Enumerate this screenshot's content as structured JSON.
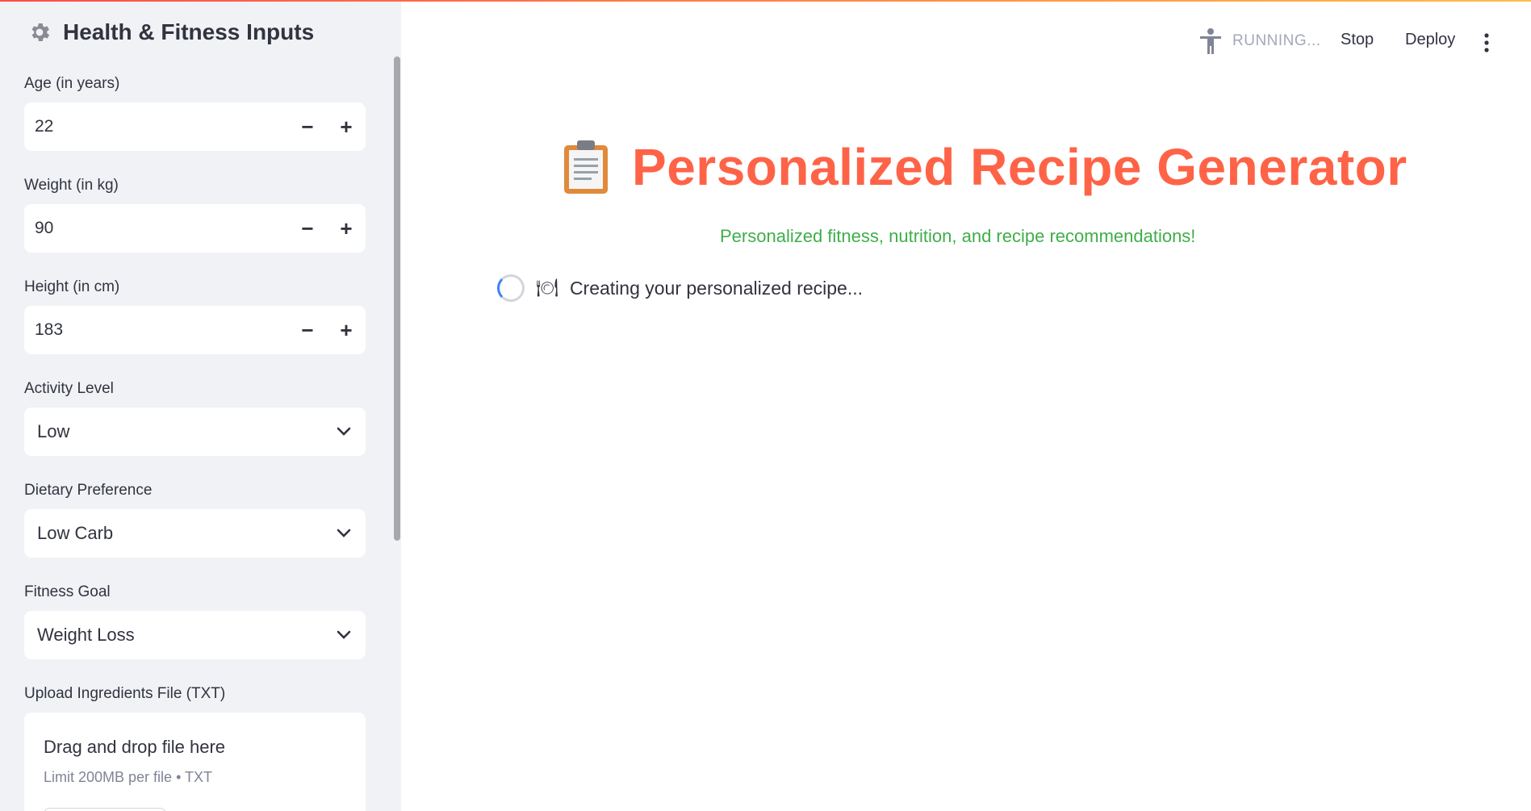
{
  "sidebar": {
    "title": "Health & Fitness Inputs",
    "title_icon": "gear-icon",
    "age": {
      "label": "Age (in years)",
      "value": "22",
      "minus": "−",
      "plus": "+"
    },
    "weight": {
      "label": "Weight (in kg)",
      "value": "90",
      "minus": "−",
      "plus": "+"
    },
    "height": {
      "label": "Height (in cm)",
      "value": "183",
      "minus": "−",
      "plus": "+"
    },
    "activity": {
      "label": "Activity Level",
      "value": "Low"
    },
    "diet": {
      "label": "Dietary Preference",
      "value": "Low Carb"
    },
    "goal": {
      "label": "Fitness Goal",
      "value": "Weight Loss"
    },
    "upload": {
      "label": "Upload Ingredients File (TXT)",
      "drop_text": "Drag and drop file here",
      "limit_text": "Limit 200MB per file • TXT"
    }
  },
  "header": {
    "status": "RUNNING...",
    "stop": "Stop",
    "deploy": "Deploy"
  },
  "main": {
    "title_icon": "clipboard-icon",
    "title": "Personalized Recipe Generator",
    "subtitle": "Personalized fitness, nutrition, and recipe recommendations!",
    "loading_text": "Creating your personalized recipe...",
    "loading_emoji": "🍽"
  },
  "colors": {
    "accent": "#ff6347",
    "subtitle": "#3fae49",
    "sidebar_bg": "#f0f2f6",
    "spinner": "#3b82f6"
  }
}
